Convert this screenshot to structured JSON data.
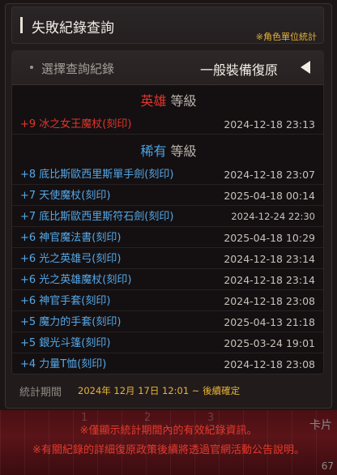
{
  "header": {
    "title": "失敗紀錄查詢",
    "note": "※角色單位統計"
  },
  "selector": {
    "label": "選擇查詢紀錄",
    "value": "一般裝備復原"
  },
  "sections": [
    {
      "grade": "英雄",
      "suffix": "等級",
      "rows": [
        {
          "name": "+9 冰之女王魔杖(刻印)",
          "date": "2024-12-18 23:13"
        }
      ]
    },
    {
      "grade": "稀有",
      "suffix": "等級",
      "rows": [
        {
          "name": "+8 底比斯歐西里斯單手劍(刻印)",
          "date": "2024-12-18 23:07"
        },
        {
          "name": "+7 天使魔杖(刻印)",
          "date": "2025-04-18 00:14"
        },
        {
          "name": "+7 底比斯歐西里斯符石劍(刻印)",
          "date": "2024-12-24 22:30"
        },
        {
          "name": "+6 神官魔法書(刻印)",
          "date": "2025-04-18 10:29"
        },
        {
          "name": "+6 光之英雄弓(刻印)",
          "date": "2024-12-18 23:14"
        },
        {
          "name": "+6 光之英雄魔杖(刻印)",
          "date": "2024-12-18 23:14"
        },
        {
          "name": "+6 神官手套(刻印)",
          "date": "2024-12-18 23:08"
        },
        {
          "name": "+5 魔力的手套(刻印)",
          "date": "2025-04-13 21:18"
        },
        {
          "name": "+5 銀光斗篷(刻印)",
          "date": "2025-03-24 19:01"
        },
        {
          "name": "+4 力量T恤(刻印)",
          "date": "2024-12-18 23:08"
        }
      ]
    }
  ],
  "footer": {
    "label": "統計期間",
    "value": "2024年 12月 17日 12:01 ~ 後續確定"
  },
  "notices": [
    "※僅顯示統計期間內的有效紀錄資訊。",
    "※有關紀錄的詳細復原政策後續將透過官網活動公告說明。"
  ],
  "background": {
    "right_text": "卡片",
    "corner_text": "67",
    "grid_numbers": [
      "1",
      "2",
      "3"
    ]
  },
  "colors": {
    "hero": "#e2352a",
    "rare": "#55a8e8",
    "note": "#e6b437"
  }
}
